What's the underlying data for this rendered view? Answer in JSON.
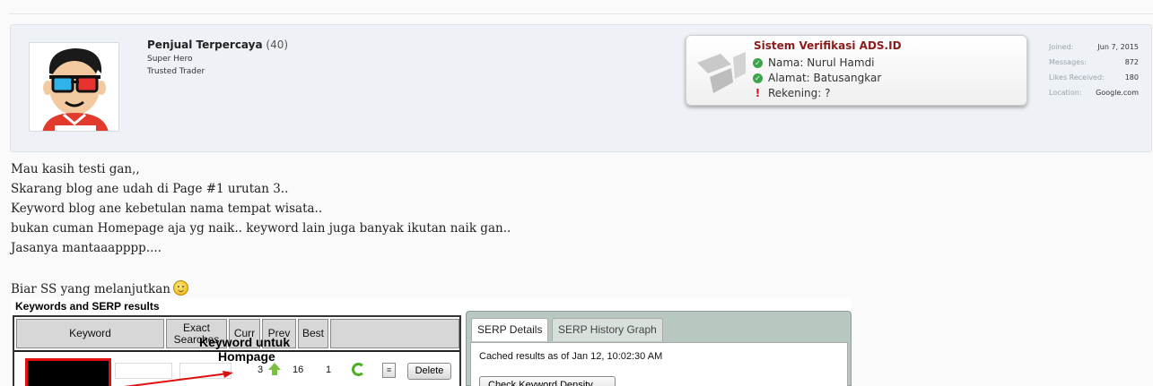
{
  "user": {
    "name": "Penjual Terpercaya",
    "post_count": "(40)",
    "titles": [
      "Super Hero",
      "Trusted Trader"
    ]
  },
  "verification": {
    "title": "Sistem Verifikasi ADS.ID",
    "rows": [
      {
        "icon": "check-icon",
        "text": "Nama: Nurul Hamdi"
      },
      {
        "icon": "check-icon",
        "text": "Alamat: Batusangkar"
      },
      {
        "icon": "exclamation-icon",
        "text": "Rekening: ?"
      }
    ],
    "title_color": "#8b1c1c"
  },
  "stats": [
    {
      "label": "Joined:",
      "value": "Jun 7, 2015"
    },
    {
      "label": "Messages:",
      "value": "872"
    },
    {
      "label": "Likes Received:",
      "value": "180"
    },
    {
      "label": "Location:",
      "value": "Google.com"
    }
  ],
  "message": {
    "lines": [
      "Mau kasih testi gan,,",
      "Skarang blog ane udah di Page #1 urutan 3..",
      "Keyword blog ane kebetulan nama tempat wisata..",
      "bukan cuman Homepage aja yg naik.. keyword lain juga banyak ikutan naik gan..",
      "Jasanya mantaaapppp....",
      "",
      "Biar SS yang melanjutkan"
    ],
    "smiley": "smiley-icon"
  },
  "screenshot": {
    "table_title": "Keywords and SERP results",
    "headers": [
      "Keyword",
      "Exact Searches",
      "Curr",
      "Prev",
      "Best"
    ],
    "row": {
      "curr": "3",
      "prev": "16",
      "best": "1",
      "delete_label": "Delete"
    },
    "annotation": [
      "Keyword untuk",
      "Hompage"
    ],
    "serp_tabs": [
      "SERP Details",
      "SERP History Graph"
    ],
    "cached_text": "Cached results as of Jan 12, 10:02:30 AM",
    "check_button": "Check Keyword Density"
  }
}
